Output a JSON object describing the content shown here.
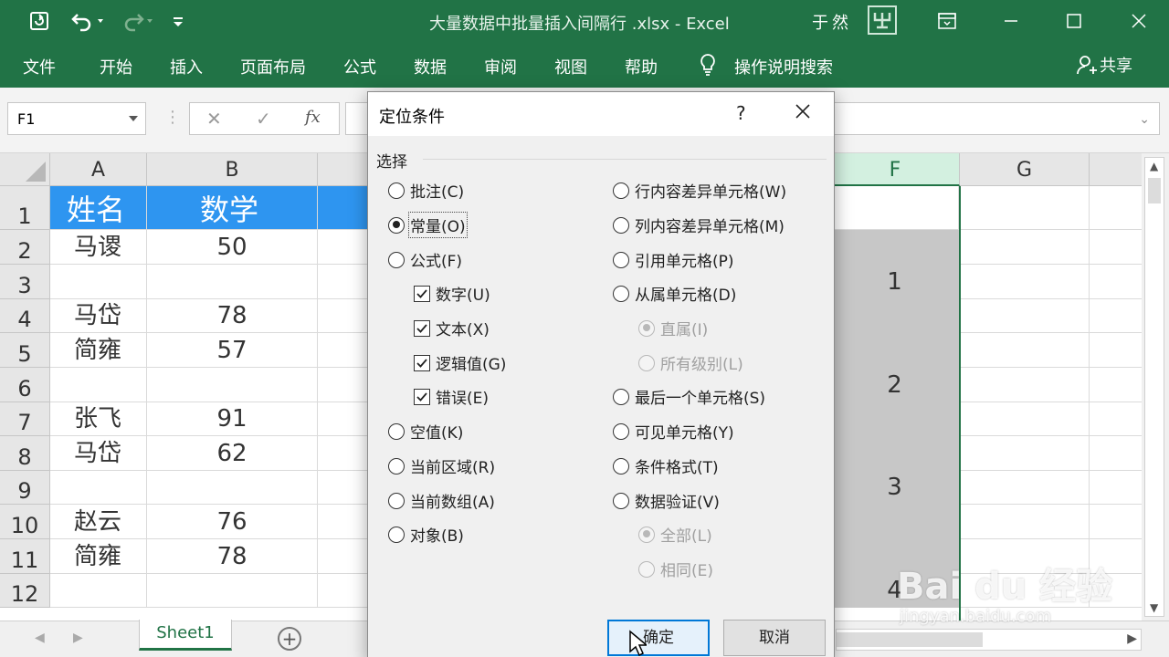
{
  "titlebar": {
    "filename": "大量数据中批量插入间隔行 .xlsx",
    "separator": "-",
    "app": "Excel",
    "title_full": "大量数据中批量插入间隔行 .xlsx  -  Excel",
    "user": "于然",
    "avatar_icon": "user-avatar-icon"
  },
  "ribbon": {
    "tabs": [
      "文件",
      "开始",
      "插入",
      "页面布局",
      "公式",
      "数据",
      "审阅",
      "视图",
      "帮助"
    ],
    "search_label": "操作说明搜索",
    "share_label": "共享"
  },
  "formula_bar": {
    "name_box": "F1",
    "fx_label": "fx",
    "formula": ""
  },
  "sheet": {
    "columns": [
      "A",
      "B",
      "F",
      "G"
    ],
    "rows": [
      "1",
      "2",
      "3",
      "4",
      "5",
      "6",
      "7",
      "8",
      "9",
      "10",
      "11",
      "12"
    ],
    "header": {
      "name": "姓名",
      "math": "数学"
    },
    "data": [
      {
        "name": "",
        "math": ""
      },
      {
        "name": "马谡",
        "math": "50"
      },
      {
        "name": "",
        "math": ""
      },
      {
        "name": "马岱",
        "math": "78"
      },
      {
        "name": "简雍",
        "math": "57"
      },
      {
        "name": "",
        "math": ""
      },
      {
        "name": "张飞",
        "math": "91"
      },
      {
        "name": "马岱",
        "math": "62"
      },
      {
        "name": "",
        "math": ""
      },
      {
        "name": "赵云",
        "math": "76"
      },
      {
        "name": "简雍",
        "math": "78"
      },
      {
        "name": "",
        "math": ""
      }
    ],
    "col_f_values": [
      "1",
      "2",
      "3",
      "4"
    ],
    "active_tab": "Sheet1"
  },
  "dialog": {
    "title": "定位条件",
    "help": "?",
    "group_label": "选择",
    "left_options": [
      {
        "label": "批注(C)",
        "checked": false
      },
      {
        "label": "常量(O)",
        "checked": true
      },
      {
        "label": "公式(F)",
        "checked": false
      },
      {
        "label": "数字(U)",
        "checked": true
      },
      {
        "label": "文本(X)",
        "checked": true
      },
      {
        "label": "逻辑值(G)",
        "checked": true
      },
      {
        "label": "错误(E)",
        "checked": true
      },
      {
        "label": "空值(K)",
        "checked": false
      },
      {
        "label": "当前区域(R)",
        "checked": false
      },
      {
        "label": "当前数组(A)",
        "checked": false
      },
      {
        "label": "对象(B)",
        "checked": false
      }
    ],
    "right_options": [
      {
        "label": "行内容差异单元格(W)",
        "checked": false,
        "enabled": true
      },
      {
        "label": "列内容差异单元格(M)",
        "checked": false,
        "enabled": true
      },
      {
        "label": "引用单元格(P)",
        "checked": false,
        "enabled": true
      },
      {
        "label": "从属单元格(D)",
        "checked": false,
        "enabled": true
      },
      {
        "label": "直属(I)",
        "checked": true,
        "enabled": false
      },
      {
        "label": "所有级别(L)",
        "checked": false,
        "enabled": false
      },
      {
        "label": "最后一个单元格(S)",
        "checked": false,
        "enabled": true
      },
      {
        "label": "可见单元格(Y)",
        "checked": false,
        "enabled": true
      },
      {
        "label": "条件格式(T)",
        "checked": false,
        "enabled": true
      },
      {
        "label": "数据验证(V)",
        "checked": false,
        "enabled": true
      },
      {
        "label": "全部(L)",
        "checked": true,
        "enabled": false
      },
      {
        "label": "相同(E)",
        "checked": false,
        "enabled": false
      }
    ],
    "ok_label": "确定",
    "cancel_label": "取消"
  },
  "watermark": {
    "brand": "Bai du 经验",
    "url": "jingyan.baidu.com"
  },
  "colors": {
    "excel_green": "#217346",
    "header_blue": "#2e95f0",
    "selection_gray": "#c7c7c7",
    "dialog_bg": "#f0f0f0",
    "primary_button_border": "#0078d7"
  }
}
